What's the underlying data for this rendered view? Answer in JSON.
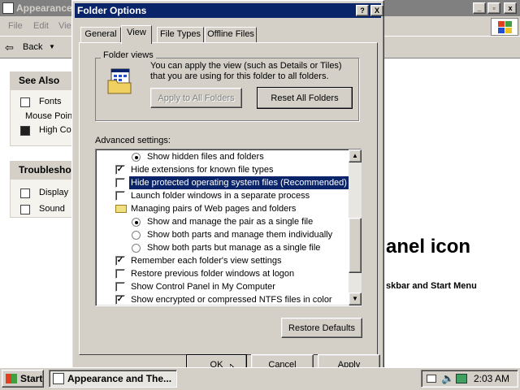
{
  "background_window": {
    "title": "Appearance",
    "menu": [
      "File",
      "Edit",
      "Vie"
    ],
    "toolbar_back": "Back",
    "see_also": {
      "heading": "See Also",
      "items": [
        "Fonts",
        "Mouse Point",
        "High Con"
      ]
    },
    "troubleshoot": {
      "heading": "Troublesho",
      "items": [
        "Display",
        "Sound"
      ]
    },
    "content_heading": "anel icon",
    "content_sub": "skbar and Start Menu"
  },
  "dialog": {
    "title": "Folder Options",
    "help_label": "?",
    "close_label": "X",
    "tabs": [
      "General",
      "View",
      "File Types",
      "Offline Files"
    ],
    "active_tab": "View",
    "folder_views": {
      "legend": "Folder views",
      "description": "You can apply the view (such as Details or Tiles) that you are using for this folder to all folders.",
      "apply_all_label": "Apply to All Folders",
      "reset_all_label": "Reset All Folders"
    },
    "advanced_label": "Advanced settings:",
    "settings": [
      {
        "type": "radio",
        "label": "Show hidden files and folders",
        "checked": true,
        "indent": 2
      },
      {
        "type": "checkbox",
        "label": "Hide extensions for known file types",
        "checked": true,
        "indent": 1
      },
      {
        "type": "checkbox",
        "label": "Hide protected operating system files (Recommended)",
        "checked": false,
        "indent": 1,
        "selected": true
      },
      {
        "type": "checkbox",
        "label": "Launch folder windows in a separate process",
        "checked": false,
        "indent": 1
      },
      {
        "type": "folder",
        "label": "Managing pairs of Web pages and folders",
        "indent": 1
      },
      {
        "type": "radio",
        "label": "Show and manage the pair as a single file",
        "checked": true,
        "indent": 2
      },
      {
        "type": "radio",
        "label": "Show both parts and manage them individually",
        "checked": false,
        "indent": 2
      },
      {
        "type": "radio",
        "label": "Show both parts but manage as a single file",
        "checked": false,
        "indent": 2
      },
      {
        "type": "checkbox",
        "label": "Remember each folder's view settings",
        "checked": true,
        "indent": 1
      },
      {
        "type": "checkbox",
        "label": "Restore previous folder windows at logon",
        "checked": false,
        "indent": 1
      },
      {
        "type": "checkbox",
        "label": "Show Control Panel in My Computer",
        "checked": false,
        "indent": 1
      },
      {
        "type": "checkbox",
        "label": "Show encrypted or compressed NTFS files in color",
        "checked": true,
        "indent": 1
      }
    ],
    "restore_defaults_label": "Restore Defaults",
    "ok_label": "OK",
    "cancel_label": "Cancel",
    "apply_label": "Apply"
  },
  "taskbar": {
    "start_label": "Start",
    "task_label": "Appearance and The...",
    "clock": "2:03 AM"
  },
  "colors": {
    "title_active": "#0a246a",
    "title_inactive": "#808080",
    "face": "#d4d0c8"
  }
}
